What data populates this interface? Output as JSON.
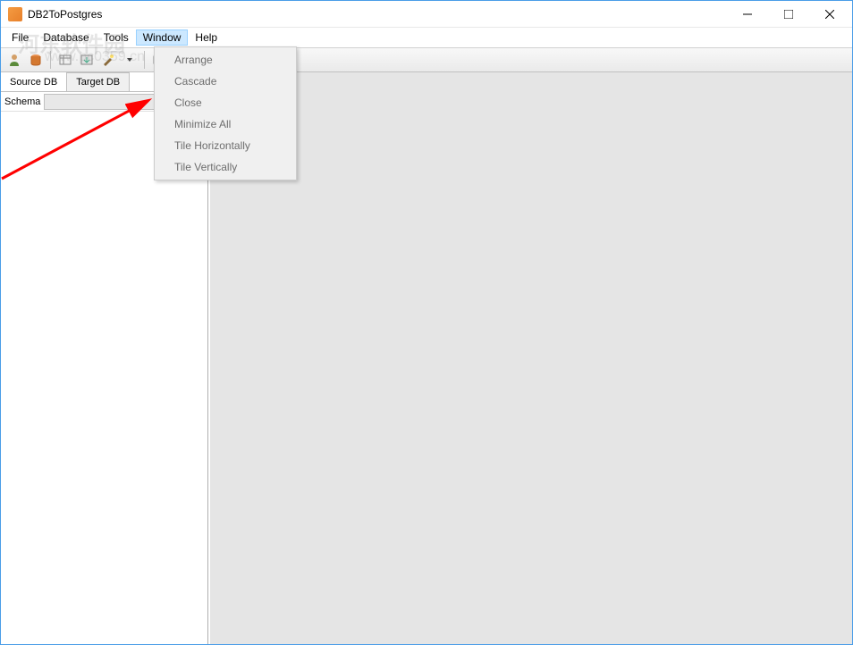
{
  "window": {
    "title": "DB2ToPostgres"
  },
  "menubar": {
    "items": [
      "File",
      "Database",
      "Tools",
      "Window",
      "Help"
    ],
    "active_index": 3
  },
  "dropdown": {
    "items": [
      "Arrange",
      "Cascade",
      "Close",
      "Minimize All",
      "Tile Horizontally",
      "Tile Vertically"
    ]
  },
  "sidebar": {
    "tabs": [
      "Source DB",
      "Target DB"
    ],
    "active_tab": 0,
    "schema_label": "Schema",
    "schema_value": ""
  },
  "watermark": {
    "text": "河东软件园",
    "url": "www.pc0359.cn"
  }
}
